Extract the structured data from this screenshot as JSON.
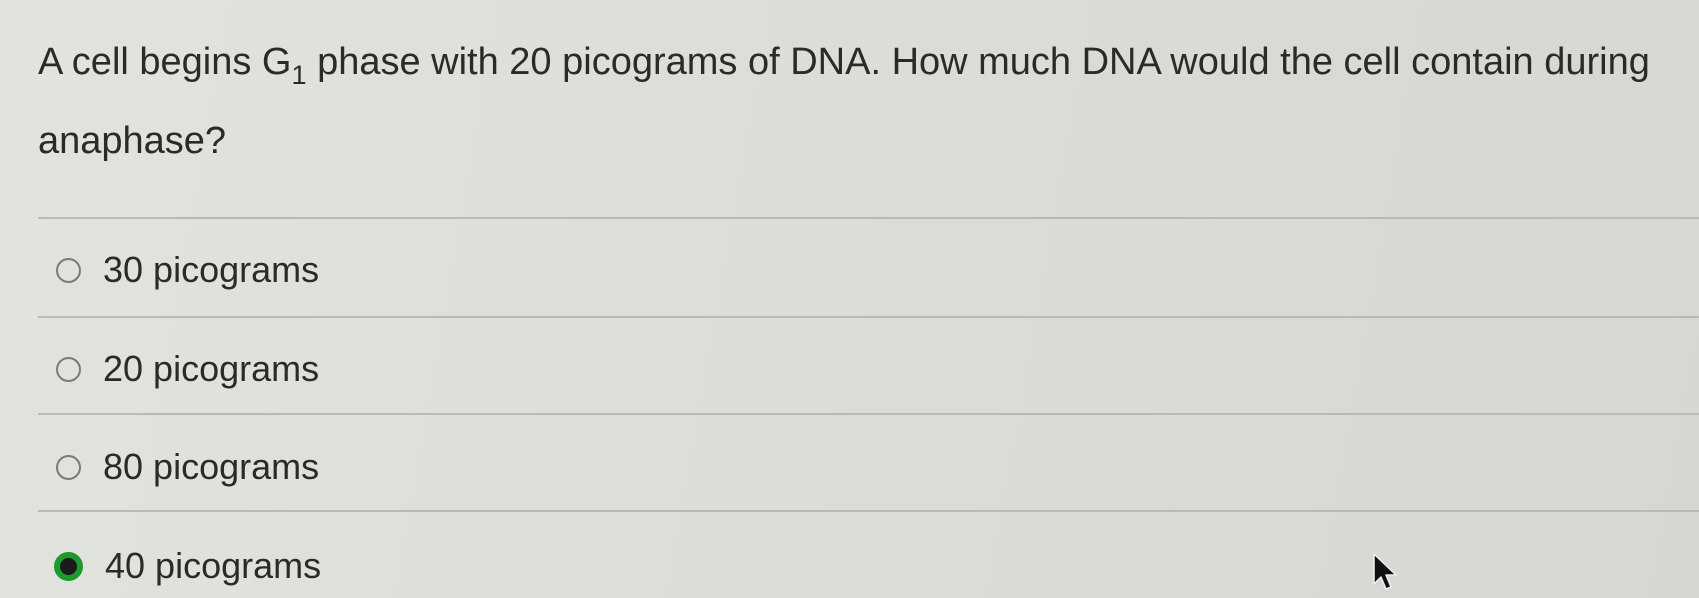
{
  "question": {
    "prefix": "A cell begins G",
    "subscript": "1",
    "suffix": " phase with 20 picograms of DNA. How much DNA would the cell contain during anaphase?"
  },
  "options": [
    {
      "label": "30 picograms",
      "selected": false
    },
    {
      "label": "20 picograms",
      "selected": false
    },
    {
      "label": "80 picograms",
      "selected": false
    },
    {
      "label": "40 picograms",
      "selected": true
    }
  ],
  "colors": {
    "selected_ring": "#1d9a2e",
    "background": "#dcddd8"
  },
  "icons": {
    "cursor": "mouse-pointer-icon"
  }
}
